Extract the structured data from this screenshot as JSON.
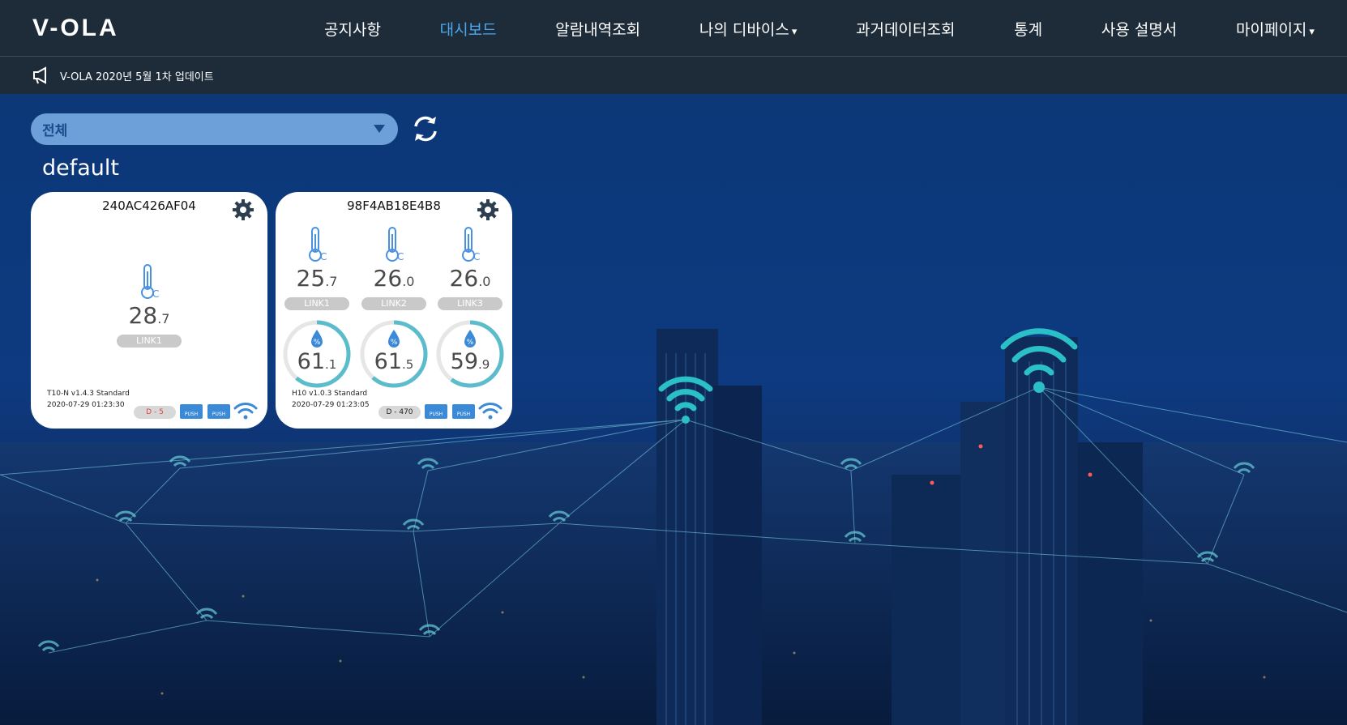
{
  "header": {
    "logo": "V-OLA",
    "nav": [
      {
        "label": "공지사항",
        "active": false,
        "caret": false
      },
      {
        "label": "대시보드",
        "active": true,
        "caret": false
      },
      {
        "label": "알람내역조회",
        "active": false,
        "caret": false
      },
      {
        "label": "나의 디바이스",
        "active": false,
        "caret": true
      },
      {
        "label": "과거데이터조회",
        "active": false,
        "caret": false
      },
      {
        "label": "통계",
        "active": false,
        "caret": false
      },
      {
        "label": "사용 설명서",
        "active": false,
        "caret": false
      },
      {
        "label": "마이페이지",
        "active": false,
        "caret": true
      }
    ],
    "caret_glyph": "▾"
  },
  "notice": {
    "icon": "megaphone-icon",
    "text": "V-OLA 2020년 5월 1차 업데이트"
  },
  "filter": {
    "selected": "전체"
  },
  "group": {
    "name": "default"
  },
  "colors": {
    "accent": "#4aa8f0",
    "topbar": "#1e2c3a",
    "select": "#6d9fd9",
    "temp_icon": "#4a90e2",
    "gauge_start": "#6ec6d8",
    "gauge_end": "#3a8ad8",
    "badge_red": "#e0403a"
  },
  "cards": [
    {
      "id": "240AC426AF04",
      "temps": [
        {
          "int": "28",
          "dec": ".7",
          "link": "LINK1"
        }
      ],
      "firmware": "T10-N v1.4.3 Standard",
      "timestamp": "2020-07-29 01:23:30",
      "d_badge": "D - 5",
      "push_labels": [
        "PUSH",
        "PUSH"
      ]
    },
    {
      "id": "98F4AB18E4B8",
      "temps": [
        {
          "int": "25",
          "dec": ".7",
          "link": "LINK1"
        },
        {
          "int": "26",
          "dec": ".0",
          "link": "LINK2"
        },
        {
          "int": "26",
          "dec": ".0",
          "link": "LINK3"
        }
      ],
      "humidity": [
        {
          "int": "61",
          "dec": ".1",
          "percent": 61.1
        },
        {
          "int": "61",
          "dec": ".5",
          "percent": 61.5
        },
        {
          "int": "59",
          "dec": ".9",
          "percent": 59.9
        }
      ],
      "firmware": "H10 v1.0.3 Standard",
      "timestamp": "2020-07-29 01:23:05",
      "d_badge": "D - 470",
      "push_labels": [
        "PUSH",
        "PUSH"
      ]
    }
  ]
}
